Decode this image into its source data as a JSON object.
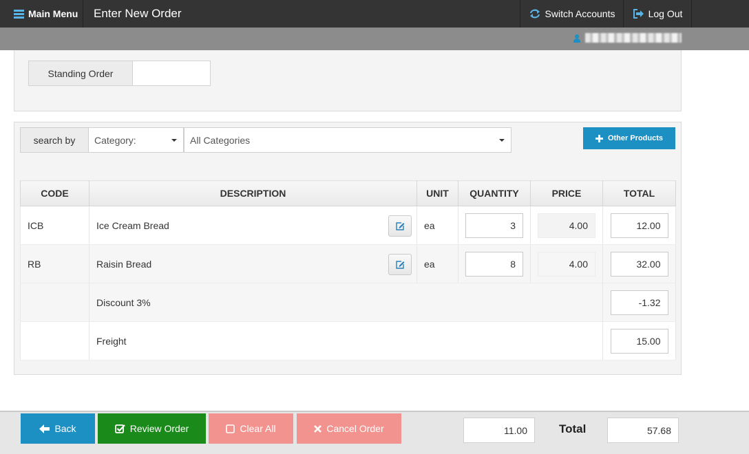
{
  "nav": {
    "main_menu": "Main Menu",
    "page_title": "Enter New Order",
    "switch_accounts": "Switch Accounts",
    "log_out": "Log Out"
  },
  "colors": {
    "nav_bg": "#343434",
    "user_bar_bg": "#8c8c8c",
    "primary": "#1c8fc3",
    "success": "#1a8a1a",
    "danger_disabled": "#f3938f"
  },
  "standing_order": {
    "label": "Standing Order",
    "value": ""
  },
  "search": {
    "label": "search by",
    "field_select": "Category:",
    "category_select": "All Categories",
    "other_products_button": "Other Products"
  },
  "table": {
    "headers": {
      "code": "CODE",
      "description": "DESCRIPTION",
      "unit": "UNIT",
      "quantity": "QUANTITY",
      "price": "PRICE",
      "total": "TOTAL"
    },
    "rows": [
      {
        "code": "ICB",
        "description": "Ice Cream Bread",
        "unit": "ea",
        "quantity": "3",
        "price": "4.00",
        "total": "12.00"
      },
      {
        "code": "RB",
        "description": "Raisin Bread",
        "unit": "ea",
        "quantity": "8",
        "price": "4.00",
        "total": "32.00"
      }
    ],
    "charges": [
      {
        "label": "Discount 3%",
        "amount": "-1.32"
      },
      {
        "label": "Freight",
        "amount": "15.00"
      }
    ]
  },
  "footer": {
    "back_button": "Back",
    "review_button": "Review Order",
    "clear_button": "Clear All",
    "cancel_button": "Cancel Order",
    "quantity_total": "11.00",
    "total_label": "Total",
    "grand_total": "57.68"
  },
  "icons": {
    "main_menu": "hamburger-icon",
    "switch_accounts": "refresh-icon",
    "log_out": "sign-out-icon",
    "user": "user-icon",
    "other_products": "plus-icon",
    "edit": "edit-icon",
    "back": "arrow-left-icon",
    "review": "check-square-icon",
    "clear": "square-icon",
    "cancel": "times-icon"
  }
}
